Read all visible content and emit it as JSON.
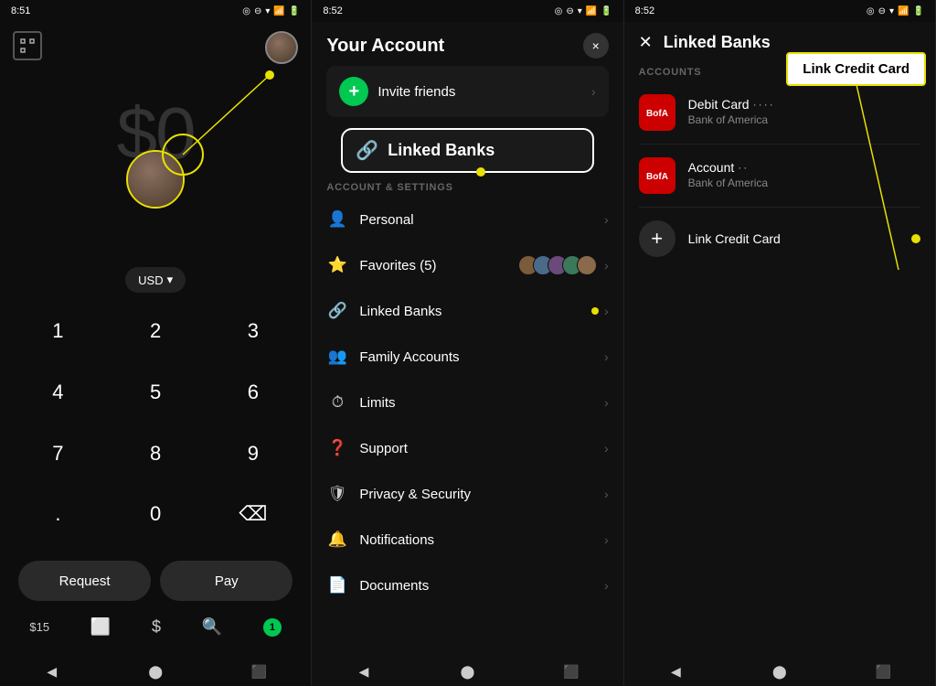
{
  "panel1": {
    "status_time": "8:51",
    "dollar_display": "$0",
    "currency": "USD",
    "numpad": [
      "1",
      "2",
      "3",
      "4",
      "5",
      "6",
      "7",
      "8",
      "9",
      ".",
      "0",
      "⌫"
    ],
    "request_label": "Request",
    "pay_label": "Pay",
    "bottom_amount": "$15",
    "nav_badge": "1"
  },
  "panel2": {
    "status_time": "8:52",
    "title": "Your Account",
    "close_icon": "×",
    "invite_label": "Invite friends",
    "section_label": "ACCOUNT & SETTINGS",
    "menu_items": [
      {
        "icon": "👤",
        "label": "Personal",
        "has_chevron": true
      },
      {
        "icon": "⭐",
        "label": "Favorites (5)",
        "has_chevron": true,
        "has_avatars": true
      },
      {
        "icon": "🔗",
        "label": "Linked Banks",
        "has_chevron": true,
        "has_dot": true
      },
      {
        "icon": "👥",
        "label": "Family Accounts",
        "has_chevron": true
      },
      {
        "icon": "⏱",
        "label": "Limits",
        "has_chevron": true
      },
      {
        "icon": "❓",
        "label": "Support",
        "has_chevron": true
      },
      {
        "icon": "🛡",
        "label": "Privacy & Security",
        "has_chevron": true
      },
      {
        "icon": "🔔",
        "label": "Notifications",
        "has_chevron": true
      },
      {
        "icon": "📄",
        "label": "Documents",
        "has_chevron": true
      }
    ],
    "linked_banks_label": "Linked Banks"
  },
  "panel3": {
    "status_time": "8:52",
    "title": "Linked Banks",
    "accounts_label": "ACCOUNTS",
    "link_credit_card_label": "Link Credit Card",
    "link_credit_card_highlight": "Link Credit Card",
    "accounts": [
      {
        "type": "Debit Card",
        "dots": "····",
        "bank": "Bank of America"
      },
      {
        "type": "Account",
        "dots": "··",
        "bank": "Bank of America"
      }
    ]
  }
}
